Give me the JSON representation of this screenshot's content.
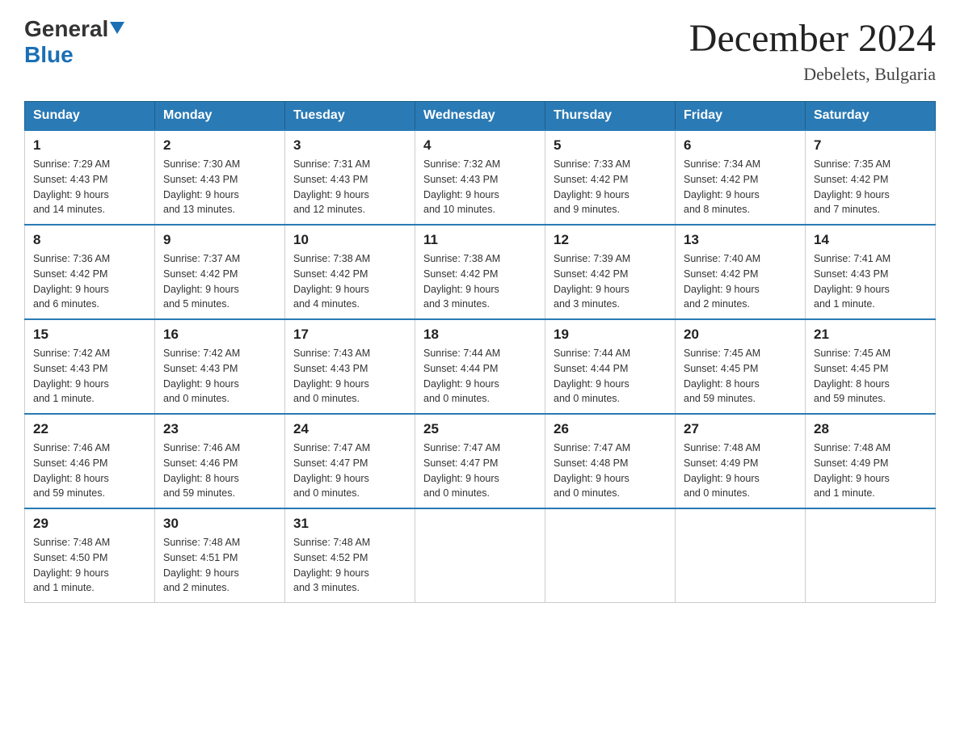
{
  "header": {
    "logo_general": "General",
    "logo_blue": "Blue",
    "title": "December 2024",
    "subtitle": "Debelets, Bulgaria"
  },
  "days_of_week": [
    "Sunday",
    "Monday",
    "Tuesday",
    "Wednesday",
    "Thursday",
    "Friday",
    "Saturday"
  ],
  "weeks": [
    [
      {
        "day": "1",
        "sunrise": "7:29 AM",
        "sunset": "4:43 PM",
        "daylight": "9 hours and 14 minutes."
      },
      {
        "day": "2",
        "sunrise": "7:30 AM",
        "sunset": "4:43 PM",
        "daylight": "9 hours and 13 minutes."
      },
      {
        "day": "3",
        "sunrise": "7:31 AM",
        "sunset": "4:43 PM",
        "daylight": "9 hours and 12 minutes."
      },
      {
        "day": "4",
        "sunrise": "7:32 AM",
        "sunset": "4:43 PM",
        "daylight": "9 hours and 10 minutes."
      },
      {
        "day": "5",
        "sunrise": "7:33 AM",
        "sunset": "4:42 PM",
        "daylight": "9 hours and 9 minutes."
      },
      {
        "day": "6",
        "sunrise": "7:34 AM",
        "sunset": "4:42 PM",
        "daylight": "9 hours and 8 minutes."
      },
      {
        "day": "7",
        "sunrise": "7:35 AM",
        "sunset": "4:42 PM",
        "daylight": "9 hours and 7 minutes."
      }
    ],
    [
      {
        "day": "8",
        "sunrise": "7:36 AM",
        "sunset": "4:42 PM",
        "daylight": "9 hours and 6 minutes."
      },
      {
        "day": "9",
        "sunrise": "7:37 AM",
        "sunset": "4:42 PM",
        "daylight": "9 hours and 5 minutes."
      },
      {
        "day": "10",
        "sunrise": "7:38 AM",
        "sunset": "4:42 PM",
        "daylight": "9 hours and 4 minutes."
      },
      {
        "day": "11",
        "sunrise": "7:38 AM",
        "sunset": "4:42 PM",
        "daylight": "9 hours and 3 minutes."
      },
      {
        "day": "12",
        "sunrise": "7:39 AM",
        "sunset": "4:42 PM",
        "daylight": "9 hours and 3 minutes."
      },
      {
        "day": "13",
        "sunrise": "7:40 AM",
        "sunset": "4:42 PM",
        "daylight": "9 hours and 2 minutes."
      },
      {
        "day": "14",
        "sunrise": "7:41 AM",
        "sunset": "4:43 PM",
        "daylight": "9 hours and 1 minute."
      }
    ],
    [
      {
        "day": "15",
        "sunrise": "7:42 AM",
        "sunset": "4:43 PM",
        "daylight": "9 hours and 1 minute."
      },
      {
        "day": "16",
        "sunrise": "7:42 AM",
        "sunset": "4:43 PM",
        "daylight": "9 hours and 0 minutes."
      },
      {
        "day": "17",
        "sunrise": "7:43 AM",
        "sunset": "4:43 PM",
        "daylight": "9 hours and 0 minutes."
      },
      {
        "day": "18",
        "sunrise": "7:44 AM",
        "sunset": "4:44 PM",
        "daylight": "9 hours and 0 minutes."
      },
      {
        "day": "19",
        "sunrise": "7:44 AM",
        "sunset": "4:44 PM",
        "daylight": "9 hours and 0 minutes."
      },
      {
        "day": "20",
        "sunrise": "7:45 AM",
        "sunset": "4:45 PM",
        "daylight": "8 hours and 59 minutes."
      },
      {
        "day": "21",
        "sunrise": "7:45 AM",
        "sunset": "4:45 PM",
        "daylight": "8 hours and 59 minutes."
      }
    ],
    [
      {
        "day": "22",
        "sunrise": "7:46 AM",
        "sunset": "4:46 PM",
        "daylight": "8 hours and 59 minutes."
      },
      {
        "day": "23",
        "sunrise": "7:46 AM",
        "sunset": "4:46 PM",
        "daylight": "8 hours and 59 minutes."
      },
      {
        "day": "24",
        "sunrise": "7:47 AM",
        "sunset": "4:47 PM",
        "daylight": "9 hours and 0 minutes."
      },
      {
        "day": "25",
        "sunrise": "7:47 AM",
        "sunset": "4:47 PM",
        "daylight": "9 hours and 0 minutes."
      },
      {
        "day": "26",
        "sunrise": "7:47 AM",
        "sunset": "4:48 PM",
        "daylight": "9 hours and 0 minutes."
      },
      {
        "day": "27",
        "sunrise": "7:48 AM",
        "sunset": "4:49 PM",
        "daylight": "9 hours and 0 minutes."
      },
      {
        "day": "28",
        "sunrise": "7:48 AM",
        "sunset": "4:49 PM",
        "daylight": "9 hours and 1 minute."
      }
    ],
    [
      {
        "day": "29",
        "sunrise": "7:48 AM",
        "sunset": "4:50 PM",
        "daylight": "9 hours and 1 minute."
      },
      {
        "day": "30",
        "sunrise": "7:48 AM",
        "sunset": "4:51 PM",
        "daylight": "9 hours and 2 minutes."
      },
      {
        "day": "31",
        "sunrise": "7:48 AM",
        "sunset": "4:52 PM",
        "daylight": "9 hours and 3 minutes."
      },
      null,
      null,
      null,
      null
    ]
  ],
  "labels": {
    "sunrise": "Sunrise:",
    "sunset": "Sunset:",
    "daylight": "Daylight:"
  }
}
